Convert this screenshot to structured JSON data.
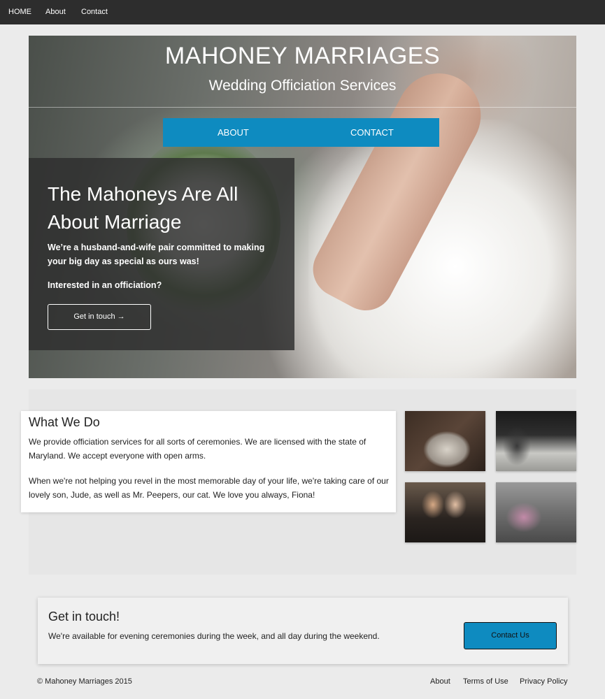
{
  "topnav": {
    "home": "HOME",
    "about": "About",
    "contact": "Contact"
  },
  "hero": {
    "title": "MAHONEY MARRIAGES",
    "subtitle": "Wedding Officiation Services",
    "nav": {
      "about": "ABOUT",
      "contact": "CONTACT"
    },
    "card": {
      "heading": "The Mahoneys Are All About Marriage",
      "text": "We’re a husband-and-wife pair committed to making your big day as special as ours was!",
      "question": "Interested in an officiation?",
      "button": "Get in touch →"
    }
  },
  "what_we_do": {
    "title": "What We Do",
    "p1": "We provide officiation services for all sorts of ceremonies. We are licensed with the state of Maryland. We accept everyone with open arms.",
    "p2": "When we're not helping you revel in the most memorable day of your life, we're taking care of our lovely son, Jude, as well as Mr. Peepers, our cat. We love you always, Fiona!"
  },
  "contact_card": {
    "title": "Get in touch!",
    "text": "We're available for evening ceremonies during the week, and all day during the weekend.",
    "button": "Contact Us"
  },
  "footer": {
    "copyright": "© Mahoney Marriages 2015",
    "links": [
      "About",
      "Terms of Use",
      "Privacy Policy"
    ]
  },
  "colors": {
    "accent": "#0e8bc0",
    "topnav_bg": "#2d2d2d",
    "page_bg": "#ebebeb"
  }
}
